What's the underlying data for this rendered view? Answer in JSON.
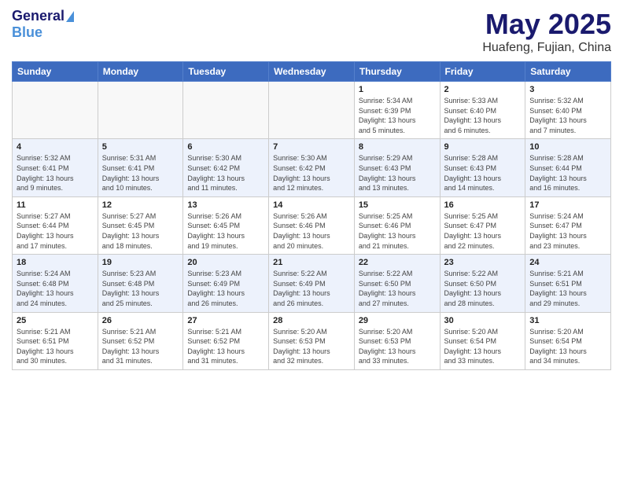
{
  "header": {
    "logo_general": "General",
    "logo_blue": "Blue",
    "title": "May 2025",
    "subtitle": "Huafeng, Fujian, China"
  },
  "calendar": {
    "days_of_week": [
      "Sunday",
      "Monday",
      "Tuesday",
      "Wednesday",
      "Thursday",
      "Friday",
      "Saturday"
    ],
    "weeks": [
      [
        {
          "day": "",
          "info": ""
        },
        {
          "day": "",
          "info": ""
        },
        {
          "day": "",
          "info": ""
        },
        {
          "day": "",
          "info": ""
        },
        {
          "day": "1",
          "info": "Sunrise: 5:34 AM\nSunset: 6:39 PM\nDaylight: 13 hours\nand 5 minutes."
        },
        {
          "day": "2",
          "info": "Sunrise: 5:33 AM\nSunset: 6:40 PM\nDaylight: 13 hours\nand 6 minutes."
        },
        {
          "day": "3",
          "info": "Sunrise: 5:32 AM\nSunset: 6:40 PM\nDaylight: 13 hours\nand 7 minutes."
        }
      ],
      [
        {
          "day": "4",
          "info": "Sunrise: 5:32 AM\nSunset: 6:41 PM\nDaylight: 13 hours\nand 9 minutes."
        },
        {
          "day": "5",
          "info": "Sunrise: 5:31 AM\nSunset: 6:41 PM\nDaylight: 13 hours\nand 10 minutes."
        },
        {
          "day": "6",
          "info": "Sunrise: 5:30 AM\nSunset: 6:42 PM\nDaylight: 13 hours\nand 11 minutes."
        },
        {
          "day": "7",
          "info": "Sunrise: 5:30 AM\nSunset: 6:42 PM\nDaylight: 13 hours\nand 12 minutes."
        },
        {
          "day": "8",
          "info": "Sunrise: 5:29 AM\nSunset: 6:43 PM\nDaylight: 13 hours\nand 13 minutes."
        },
        {
          "day": "9",
          "info": "Sunrise: 5:28 AM\nSunset: 6:43 PM\nDaylight: 13 hours\nand 14 minutes."
        },
        {
          "day": "10",
          "info": "Sunrise: 5:28 AM\nSunset: 6:44 PM\nDaylight: 13 hours\nand 16 minutes."
        }
      ],
      [
        {
          "day": "11",
          "info": "Sunrise: 5:27 AM\nSunset: 6:44 PM\nDaylight: 13 hours\nand 17 minutes."
        },
        {
          "day": "12",
          "info": "Sunrise: 5:27 AM\nSunset: 6:45 PM\nDaylight: 13 hours\nand 18 minutes."
        },
        {
          "day": "13",
          "info": "Sunrise: 5:26 AM\nSunset: 6:45 PM\nDaylight: 13 hours\nand 19 minutes."
        },
        {
          "day": "14",
          "info": "Sunrise: 5:26 AM\nSunset: 6:46 PM\nDaylight: 13 hours\nand 20 minutes."
        },
        {
          "day": "15",
          "info": "Sunrise: 5:25 AM\nSunset: 6:46 PM\nDaylight: 13 hours\nand 21 minutes."
        },
        {
          "day": "16",
          "info": "Sunrise: 5:25 AM\nSunset: 6:47 PM\nDaylight: 13 hours\nand 22 minutes."
        },
        {
          "day": "17",
          "info": "Sunrise: 5:24 AM\nSunset: 6:47 PM\nDaylight: 13 hours\nand 23 minutes."
        }
      ],
      [
        {
          "day": "18",
          "info": "Sunrise: 5:24 AM\nSunset: 6:48 PM\nDaylight: 13 hours\nand 24 minutes."
        },
        {
          "day": "19",
          "info": "Sunrise: 5:23 AM\nSunset: 6:48 PM\nDaylight: 13 hours\nand 25 minutes."
        },
        {
          "day": "20",
          "info": "Sunrise: 5:23 AM\nSunset: 6:49 PM\nDaylight: 13 hours\nand 26 minutes."
        },
        {
          "day": "21",
          "info": "Sunrise: 5:22 AM\nSunset: 6:49 PM\nDaylight: 13 hours\nand 26 minutes."
        },
        {
          "day": "22",
          "info": "Sunrise: 5:22 AM\nSunset: 6:50 PM\nDaylight: 13 hours\nand 27 minutes."
        },
        {
          "day": "23",
          "info": "Sunrise: 5:22 AM\nSunset: 6:50 PM\nDaylight: 13 hours\nand 28 minutes."
        },
        {
          "day": "24",
          "info": "Sunrise: 5:21 AM\nSunset: 6:51 PM\nDaylight: 13 hours\nand 29 minutes."
        }
      ],
      [
        {
          "day": "25",
          "info": "Sunrise: 5:21 AM\nSunset: 6:51 PM\nDaylight: 13 hours\nand 30 minutes."
        },
        {
          "day": "26",
          "info": "Sunrise: 5:21 AM\nSunset: 6:52 PM\nDaylight: 13 hours\nand 31 minutes."
        },
        {
          "day": "27",
          "info": "Sunrise: 5:21 AM\nSunset: 6:52 PM\nDaylight: 13 hours\nand 31 minutes."
        },
        {
          "day": "28",
          "info": "Sunrise: 5:20 AM\nSunset: 6:53 PM\nDaylight: 13 hours\nand 32 minutes."
        },
        {
          "day": "29",
          "info": "Sunrise: 5:20 AM\nSunset: 6:53 PM\nDaylight: 13 hours\nand 33 minutes."
        },
        {
          "day": "30",
          "info": "Sunrise: 5:20 AM\nSunset: 6:54 PM\nDaylight: 13 hours\nand 33 minutes."
        },
        {
          "day": "31",
          "info": "Sunrise: 5:20 AM\nSunset: 6:54 PM\nDaylight: 13 hours\nand 34 minutes."
        }
      ]
    ]
  }
}
